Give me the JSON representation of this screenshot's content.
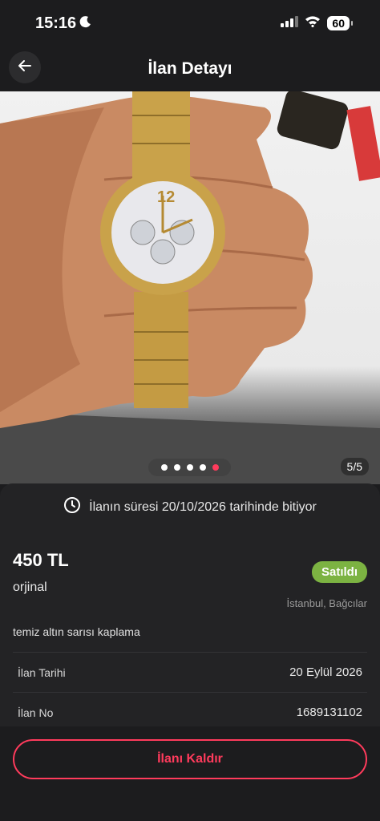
{
  "status_bar": {
    "time": "15:16",
    "battery": "60"
  },
  "header": {
    "title": "İlan Detayı"
  },
  "gallery": {
    "counter": "5/5",
    "dot_count": 5,
    "active_index": 4
  },
  "listing": {
    "expiry_text": "İlanın süresi 20/10/2026 tarihinde bitiyor",
    "price": "450 TL",
    "title": "orjinal",
    "status_badge": "Satıldı",
    "location": "İstanbul, Bağcılar",
    "description": "temiz altın sarısı kaplama",
    "details": [
      {
        "label": "İlan Tarihi",
        "value": "20 Eylül 2026"
      },
      {
        "label": "İlan No",
        "value": "1689131102"
      }
    ]
  },
  "actions": {
    "remove_label": "İlanı Kaldır"
  },
  "colors": {
    "accent": "#ff3b5c",
    "badge": "#7cb342",
    "background": "#1c1c1e"
  }
}
